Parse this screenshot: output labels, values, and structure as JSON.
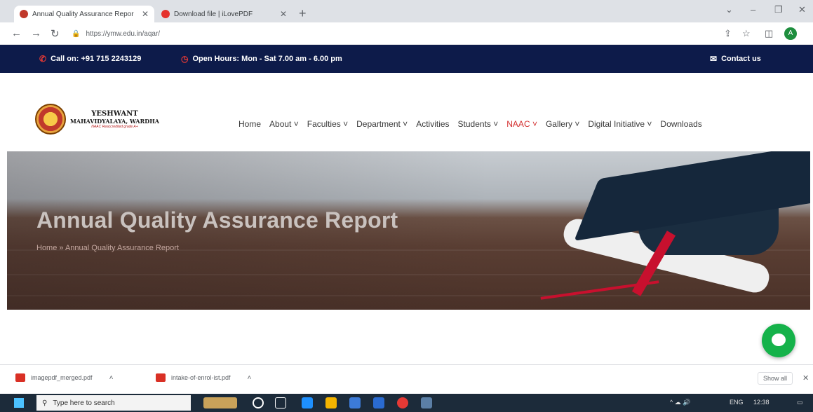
{
  "browser": {
    "tabs": [
      {
        "label": "Annual Quality Assurance Repor",
        "color": "#c0392b"
      },
      {
        "label": "Download file | iLovePDF",
        "color": "#e5322d"
      }
    ],
    "new_tab": "+",
    "url": "https://ymw.edu.in/aqar/"
  },
  "topbar": {
    "call": "Call on: +91 715 2243129",
    "hours": "Open Hours: Mon - Sat 7.00 am - 6.00 pm",
    "contact": "Contact us"
  },
  "logo": {
    "line1": "YESHWANT",
    "line2": "MAHAVIDYALAYA, WARDHA",
    "line3": "NAAC Reaccredited grade A+"
  },
  "nav": [
    {
      "label": "Home",
      "caret": false,
      "active": false
    },
    {
      "label": "About",
      "caret": true,
      "active": false
    },
    {
      "label": "Faculties",
      "caret": true,
      "active": false
    },
    {
      "label": "Department",
      "caret": true,
      "active": false
    },
    {
      "label": "Activities",
      "caret": false,
      "active": false
    },
    {
      "label": "Students",
      "caret": true,
      "active": false
    },
    {
      "label": "NAAC",
      "caret": true,
      "active": true
    },
    {
      "label": "Gallery",
      "caret": true,
      "active": false
    },
    {
      "label": "Digital Initiative",
      "caret": true,
      "active": false
    },
    {
      "label": "Downloads",
      "caret": false,
      "active": false
    }
  ],
  "hero": {
    "title": "Annual Quality Assurance Report",
    "breadcrumb": "Home  » Annual Quality Assurance Report"
  },
  "downloads": {
    "items": [
      "imagepdf_merged.pdf",
      "intake-of-enrol-ist.pdf"
    ],
    "show_all": "Show all"
  },
  "taskbar": {
    "search_placeholder": "Type here to search",
    "tray_text": "ENG",
    "time": "12:38"
  },
  "colors": {
    "brand_dark": "#0d1b4a",
    "accent_red": "#d32f2f",
    "chat_green": "#15b24a"
  }
}
